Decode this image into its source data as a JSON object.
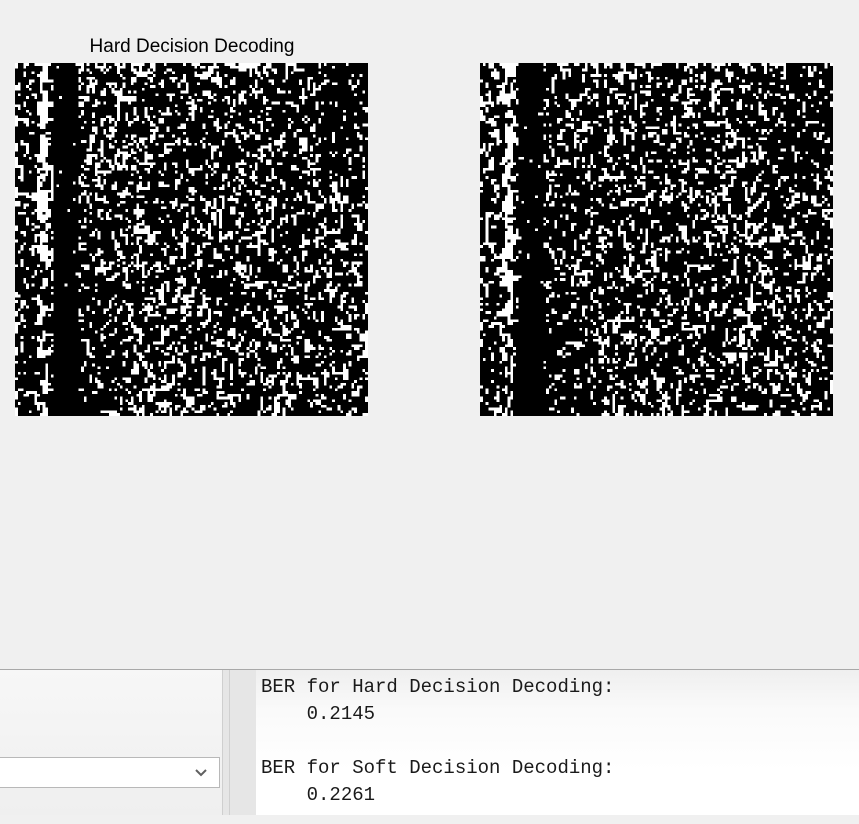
{
  "figure": {
    "left_axes": {
      "title": "Hard Decision Decoding"
    },
    "right_axes": {
      "title": ""
    }
  },
  "left_panel": {
    "dropdown": {
      "selected_value": "",
      "icon": "chevron-down-icon"
    }
  },
  "command_window": {
    "lines": [
      "BER for Hard Decision Decoding:",
      "    0.2145",
      "",
      "BER for Soft Decision Decoding:",
      "    0.2261"
    ]
  },
  "colors": {
    "figure_background": "#f0f0f0",
    "image_black": "#000000",
    "image_white": "#ffffff"
  }
}
